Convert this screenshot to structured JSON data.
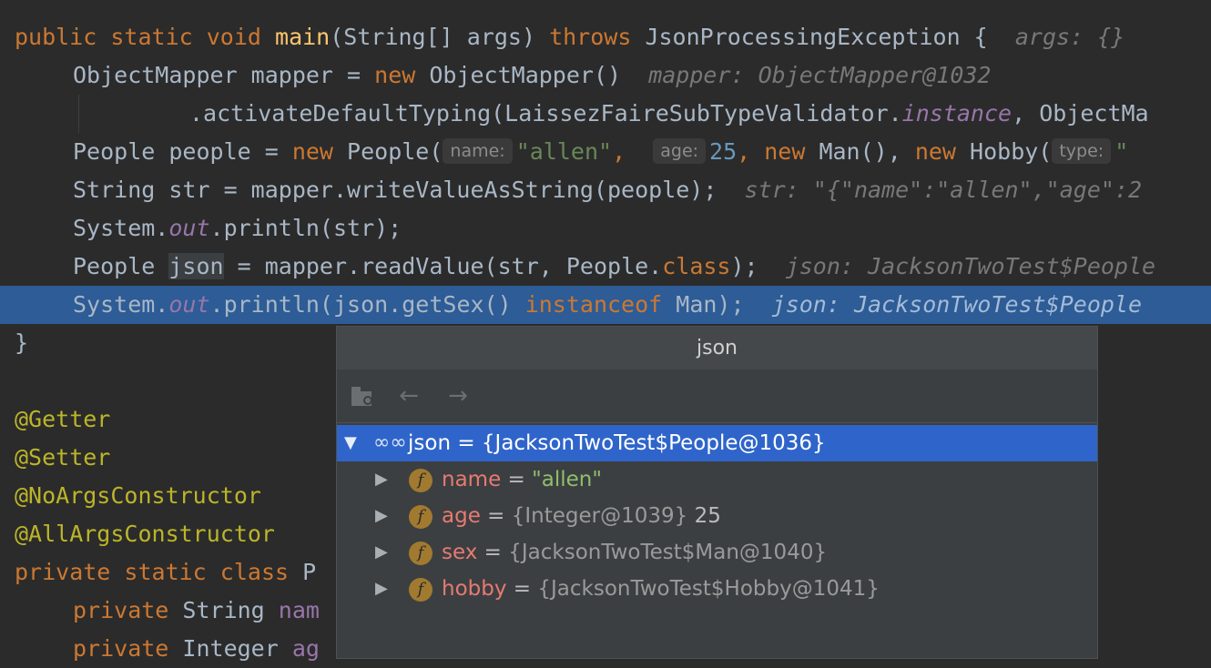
{
  "code": {
    "line1": {
      "kw1": "public",
      "kw2": "static",
      "kw3": "void",
      "fn": "main",
      "p1": "(String[] args) ",
      "kw4": "throws",
      "p2": " JsonProcessingException {",
      "hint": "args: {}"
    },
    "line2": {
      "p1": "ObjectMapper mapper = ",
      "kw": "new",
      "p2": " ObjectMapper()",
      "hint": "mapper: ObjectMapper@1032"
    },
    "line3": {
      "p1": ".activateDefaultTyping(LaissezFaireSubTypeValidator.",
      "st": "instance",
      "p2": ", ObjectMa"
    },
    "line4": {
      "p1": "People people = ",
      "kw1": "new",
      "p2": " People(",
      "h1": "name:",
      "s1": "\"allen\"",
      "c1": ", ",
      "h2": "age:",
      "n1": "25",
      "c2": ", ",
      "kw2": "new",
      "p3": " Man(), ",
      "kw3": "new",
      "p4": " Hobby(",
      "h3": "type:",
      "s2": "\""
    },
    "line5": {
      "p1": "String str = mapper.writeValueAsString(people);",
      "hint": "str: \"{\"name\":\"allen\",\"age\":2"
    },
    "line6": {
      "p1": "System.",
      "st": "out",
      "p2": ".println(str);"
    },
    "line7": {
      "p1": "People ",
      "id": "json",
      "p2": " = mapper.readValue(str, People.",
      "kw": "class",
      "p3": ");",
      "hint": "json: JacksonTwoTest$People"
    },
    "line8": {
      "p1": "System.",
      "st": "out",
      "p2": ".println(json.getSex() ",
      "kw": "instanceof",
      "p3": " Man);",
      "hint": "json: JacksonTwoTest$People"
    },
    "line9": "}",
    "line11": "@Getter",
    "line12": "@Setter",
    "line13": "@NoArgsConstructor",
    "line14": "@AllArgsConstructor",
    "line15": {
      "kw1": "private",
      "kw2": "static",
      "kw3": "class",
      "p1": " P"
    },
    "line16": {
      "kw": "private",
      "p1": " String ",
      "fld": "nam"
    },
    "line17": {
      "kw": "private",
      "p1": " Integer ",
      "fld": "ag"
    }
  },
  "popup": {
    "title": "json",
    "toolbar": {
      "group_icon": "object-group-icon",
      "back_icon": "arrow-left-icon",
      "forward_icon": "arrow-right-icon"
    },
    "root": {
      "icon": "glasses-icon",
      "text": "json = {JacksonTwoTest$People@1036}"
    },
    "fields": [
      {
        "name": "name",
        "eq": " = ",
        "value": "\"allen\"",
        "extra": ""
      },
      {
        "name": "age",
        "eq": " = ",
        "value": "{Integer@1039}",
        "extra": " 25"
      },
      {
        "name": "sex",
        "eq": " = ",
        "value": "{JacksonTwoTest$Man@1040}",
        "extra": ""
      },
      {
        "name": "hobby",
        "eq": " = ",
        "value": "{JacksonTwoTest$Hobby@1041}",
        "extra": ""
      }
    ],
    "field_badge": "f"
  },
  "colors": {
    "background": "#2b2b2b",
    "highlight": "#2d5c96",
    "selection": "#2f65ca",
    "keyword": "#cc7832"
  }
}
